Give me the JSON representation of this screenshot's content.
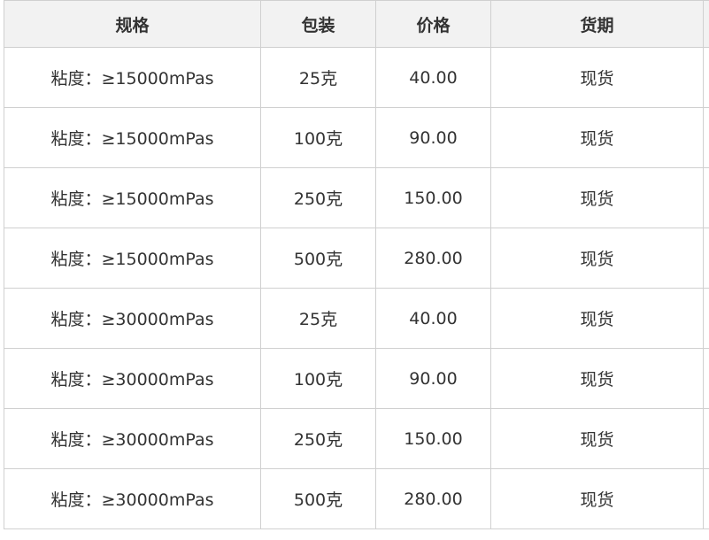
{
  "table": {
    "headers": [
      "规格",
      "包装",
      "价格",
      "货期"
    ],
    "rows": [
      [
        "粘度：≥15000mPas",
        "25克",
        "40.00",
        "现货"
      ],
      [
        "粘度：≥15000mPas",
        "100克",
        "90.00",
        "现货"
      ],
      [
        "粘度：≥15000mPas",
        "250克",
        "150.00",
        "现货"
      ],
      [
        "粘度：≥15000mPas",
        "500克",
        "280.00",
        "现货"
      ],
      [
        "粘度：≥30000mPas",
        "25克",
        "40.00",
        "现货"
      ],
      [
        "粘度：≥30000mPas",
        "100克",
        "90.00",
        "现货"
      ],
      [
        "粘度：≥30000mPas",
        "250克",
        "150.00",
        "现货"
      ],
      [
        "粘度：≥30000mPas",
        "500克",
        "280.00",
        "现货"
      ]
    ]
  },
  "colors": {
    "header_bg": "#f2f2f2",
    "border": "#d0d0d0",
    "text": "#333333"
  }
}
